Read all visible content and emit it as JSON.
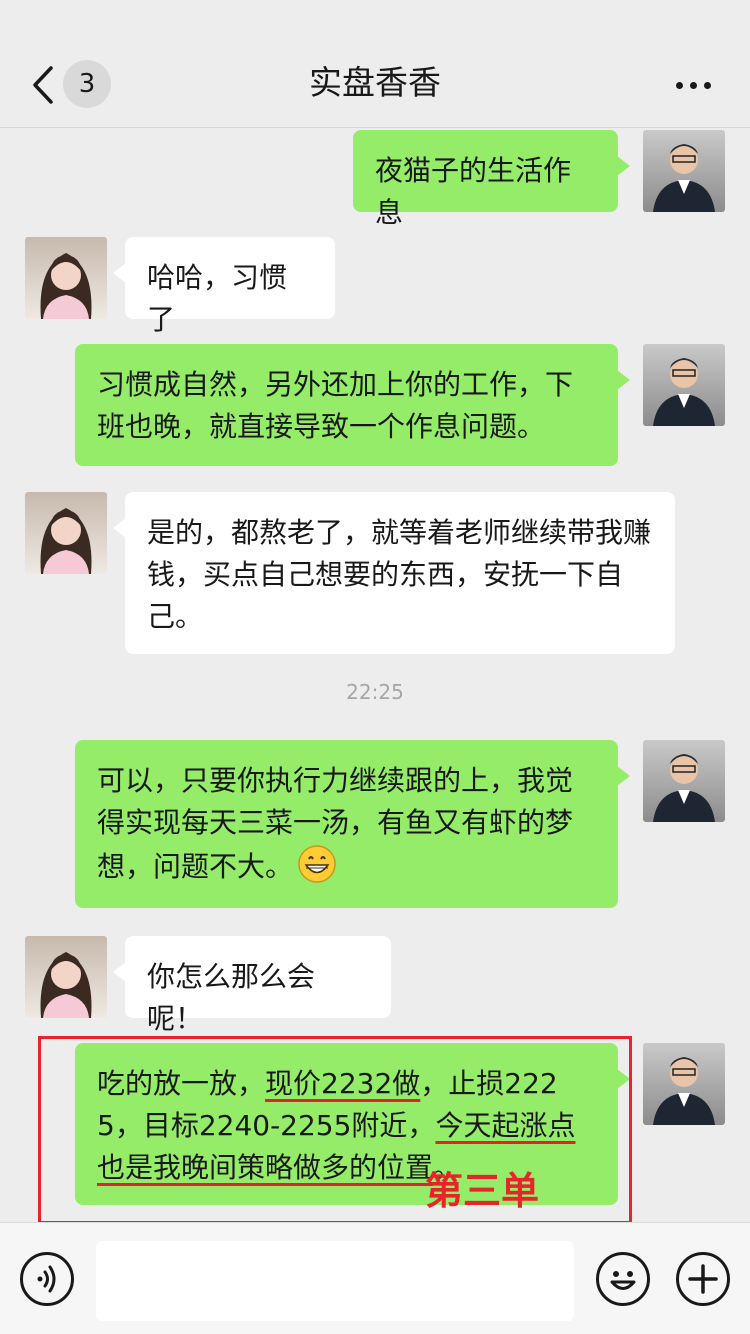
{
  "header": {
    "title": "实盘香香",
    "unread_count": "3"
  },
  "messages": [
    {
      "sender": "me",
      "text": "夜猫子的生活作息"
    },
    {
      "sender": "other",
      "text": "哈哈，习惯了"
    },
    {
      "sender": "me",
      "text": "习惯成自然，另外还加上你的工作，下班也晚，就直接导致一个作息问题。"
    },
    {
      "sender": "other",
      "text": "是的，都熬老了，就等着老师继续带我赚钱，买点自己想要的东西，安抚一下自己。"
    },
    {
      "sender": "me",
      "text": "可以，只要你执行力继续跟的上，我觉得实现每天三菜一汤，有鱼又有虾的梦想，问题不大。",
      "emoji": "grinning-face"
    },
    {
      "sender": "other",
      "text": "你怎么那么会呢！"
    },
    {
      "sender": "me",
      "segments": [
        "吃的放一放，",
        "现价2232做",
        "，止损2225，目标2240-2255附近，",
        "今天起涨点也是我晚间策略做多的位置",
        "。"
      ]
    }
  ],
  "timestamp": "22:25",
  "annotation": {
    "label": "第三单",
    "color": "#e8242b"
  },
  "colors": {
    "my_bubble": "#95ec69",
    "other_bubble": "#ffffff",
    "background": "#ededed"
  },
  "icons": {
    "back": "chevron-left-icon",
    "more": "more-dots-icon",
    "voice": "voice-icon",
    "emoji": "emoji-icon",
    "add": "plus-icon"
  }
}
